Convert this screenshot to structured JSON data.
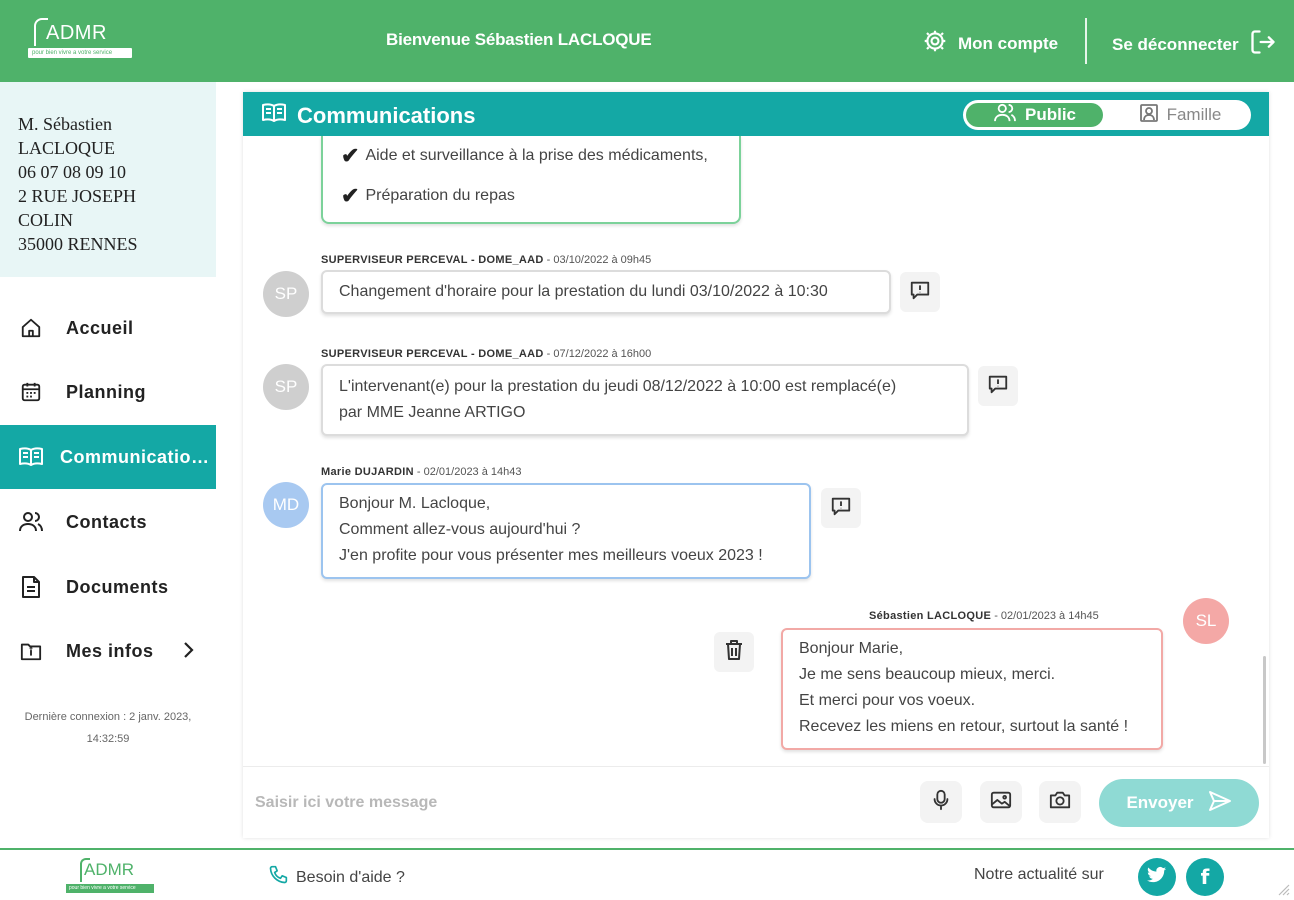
{
  "header": {
    "logo_text": "ADMR",
    "logo_tagline": "pour bien vivre a votre service",
    "welcome": "Bienvenue Sébastien LACLOQUE",
    "account_label": "Mon compte",
    "logout_label": "Se déconnecter",
    "color": "#4fb26a"
  },
  "user": {
    "line1": "M. Sébastien",
    "line2": "LACLOQUE",
    "phone": "06 07 08 09 10",
    "address1": "2 RUE JOSEPH",
    "address2": "COLIN",
    "city": "35000 RENNES"
  },
  "nav": {
    "items": [
      {
        "label": "Accueil",
        "icon": "home-icon"
      },
      {
        "label": "Planning",
        "icon": "calendar-icon"
      },
      {
        "label": "Communications",
        "icon": "book-icon",
        "active": true
      },
      {
        "label": "Contacts",
        "icon": "people-icon"
      },
      {
        "label": "Documents",
        "icon": "document-icon"
      },
      {
        "label": "Mes infos",
        "icon": "folder-info-icon"
      }
    ],
    "last_connection_1": "Dernière connexion : 2 janv. 2023,",
    "last_connection_2": "14:32:59",
    "accent": "#14a8a5"
  },
  "panel": {
    "title": "Communications",
    "toggle_public": "Public",
    "toggle_family": "Famille",
    "selected": "Public"
  },
  "messages": [
    {
      "type": "checklist",
      "items": [
        "Aide et surveillance à la prise des médicaments,",
        "Préparation du repas"
      ]
    },
    {
      "initials": "SP",
      "author": "SUPERVISEUR PERCEVAL - DOME_AAD",
      "date": " - 03/10/2022 à 09h45",
      "lines": [
        "Changement d'horaire pour la prestation du lundi 03/10/2022 à 10:30"
      ]
    },
    {
      "initials": "SP",
      "author": "SUPERVISEUR PERCEVAL - DOME_AAD",
      "date": " - 07/12/2022 à 16h00",
      "lines": [
        "L'intervenant(e) pour la prestation du jeudi 08/12/2022 à 10:00 est remplacé(e)",
        "par MME Jeanne ARTIGO"
      ]
    },
    {
      "initials": "MD",
      "author": "Marie DUJARDIN",
      "date": " - 02/01/2023 à 14h43",
      "lines": [
        "Bonjour M. Lacloque,",
        "Comment allez-vous aujourd'hui ?",
        "J'en profite pour vous présenter mes meilleurs voeux 2023 !"
      ]
    },
    {
      "initials": "SL",
      "author": "Sébastien LACLOQUE",
      "date": " - 02/01/2023 à 14h45",
      "lines": [
        "Bonjour Marie,",
        "Je me sens beaucoup mieux, merci.",
        "Et merci pour vos voeux.",
        "Recevez les miens en retour, surtout la santé !"
      ]
    }
  ],
  "composer": {
    "placeholder": "Saisir ici votre message",
    "send_label": "Envoyer"
  },
  "footer": {
    "logo_text": "ADMR",
    "logo_tagline": "pour bien vivre a votre service",
    "help_label": "Besoin d'aide ?",
    "news_label": "Notre actualité sur"
  }
}
